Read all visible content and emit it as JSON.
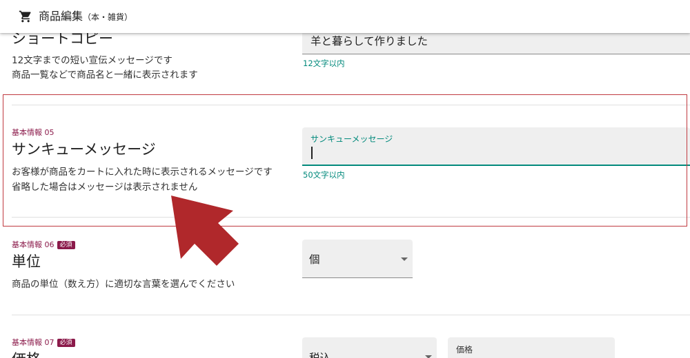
{
  "app_bar": {
    "title": "商品編集",
    "subtitle": "（本・雑貨）"
  },
  "sections": {
    "short_copy": {
      "heading": "ショートコピー",
      "desc_line1": "12文字までの短い宣伝メッセージです",
      "desc_line2": "商品一覧などで商品名と一緒に表示されます",
      "value": "羊と暮らして作りました",
      "helper": "12文字以内"
    },
    "thankyou": {
      "tag": "基本情報 05",
      "heading": "サンキューメッセージ",
      "desc_line1": "お客様が商品をカートに入れた時に表示されるメッセージです",
      "desc_line2": "省略した場合はメッセージは表示されません",
      "label": "サンキューメッセージ",
      "value": "",
      "helper": "50文字以内"
    },
    "unit": {
      "tag": "基本情報 06",
      "required": "必須",
      "heading": "単位",
      "desc": "商品の単位（数え方）に適切な言葉を選んでください",
      "selected": "個"
    },
    "price": {
      "tag": "基本情報 07",
      "required": "必須",
      "heading": "価格",
      "tax_selected": "税込",
      "price_label": "価格"
    }
  },
  "colors": {
    "accent": "#00897b",
    "tag": "#8b1a4a",
    "annotation": "#b0282b"
  },
  "icons": {
    "app_bar": "shopping-cart-icon",
    "select": "dropdown-arrow-icon",
    "annotation": "pointer-arrow-annotation"
  }
}
